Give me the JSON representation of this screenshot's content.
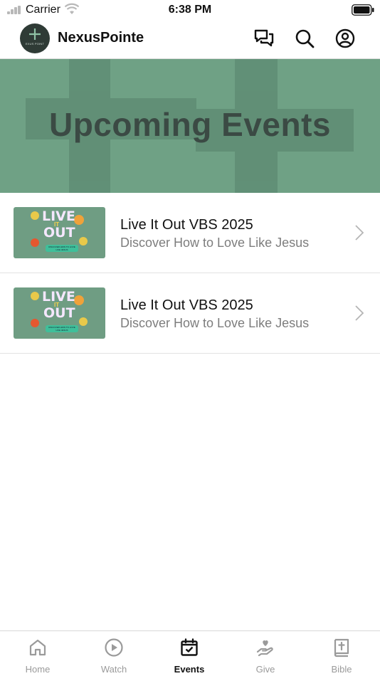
{
  "status_bar": {
    "carrier": "Carrier",
    "time": "6:38 PM"
  },
  "header": {
    "app_name": "NexusPointe",
    "logo_text": "EXUS POINT",
    "icons": [
      "chat-icon",
      "search-icon",
      "profile-icon"
    ]
  },
  "hero": {
    "title": "Upcoming Events",
    "background": "#6fa185",
    "text_color": "#3b4a44"
  },
  "events": [
    {
      "title": "Live It Out VBS 2025",
      "subtitle": "Discover How to Love Like Jesus",
      "thumb_line1": "LIVE",
      "thumb_line2": "IT",
      "thumb_line3": "OUT",
      "thumb_tagline": "DISCOVER HOW TO LOVE LIKE JESUS"
    },
    {
      "title": "Live It Out VBS 2025",
      "subtitle": "Discover How to Love Like Jesus",
      "thumb_line1": "LIVE",
      "thumb_line2": "IT",
      "thumb_line3": "OUT",
      "thumb_tagline": "DISCOVER HOW TO LOVE LIKE JESUS"
    }
  ],
  "tabs": [
    {
      "label": "Home",
      "icon": "home-icon",
      "active": false
    },
    {
      "label": "Watch",
      "icon": "play-icon",
      "active": false
    },
    {
      "label": "Events",
      "icon": "calendar-check-icon",
      "active": true
    },
    {
      "label": "Give",
      "icon": "give-hand-heart-icon",
      "active": false
    },
    {
      "label": "Bible",
      "icon": "bible-icon",
      "active": false
    }
  ]
}
